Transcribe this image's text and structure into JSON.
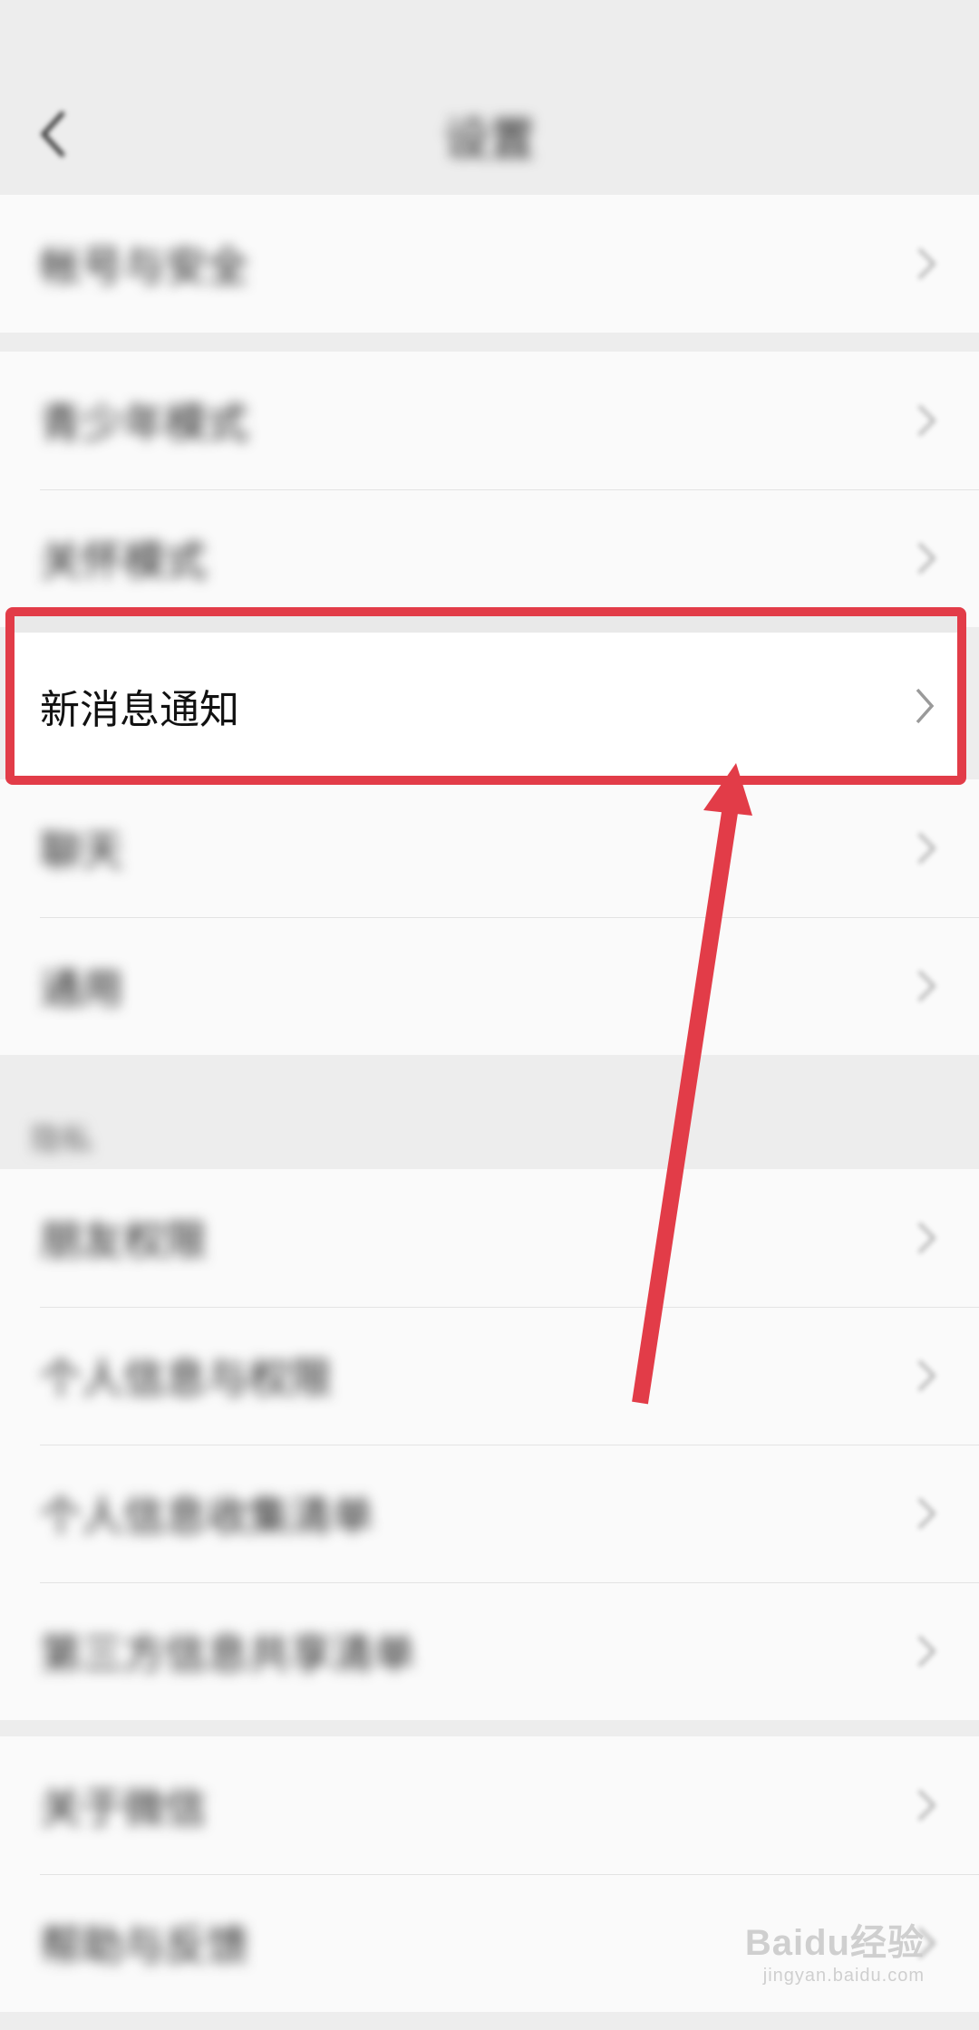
{
  "status_bar": {
    "left": "",
    "right": ""
  },
  "header": {
    "title": "设置"
  },
  "groups": [
    {
      "items": [
        {
          "label": "帐号与安全"
        }
      ]
    },
    {
      "items": [
        {
          "label": "青少年模式"
        },
        {
          "label": "关怀模式"
        }
      ]
    },
    {
      "items": [
        {
          "label": "新消息通知"
        },
        {
          "label": "聊天"
        },
        {
          "label": "通用"
        }
      ]
    }
  ],
  "section_header": "隐私",
  "privacy_items": [
    {
      "label": "朋友权限"
    },
    {
      "label": "个人信息与权限"
    },
    {
      "label": "个人信息收集清单"
    },
    {
      "label": "第三方信息共享清单"
    }
  ],
  "bottom_items": [
    {
      "label": "关于微信"
    },
    {
      "label": "帮助与反馈"
    }
  ],
  "annotation": {
    "highlight_color": "#e23c48"
  },
  "watermark": {
    "brand": "Baidu经验",
    "url": "jingyan.baidu.com"
  }
}
